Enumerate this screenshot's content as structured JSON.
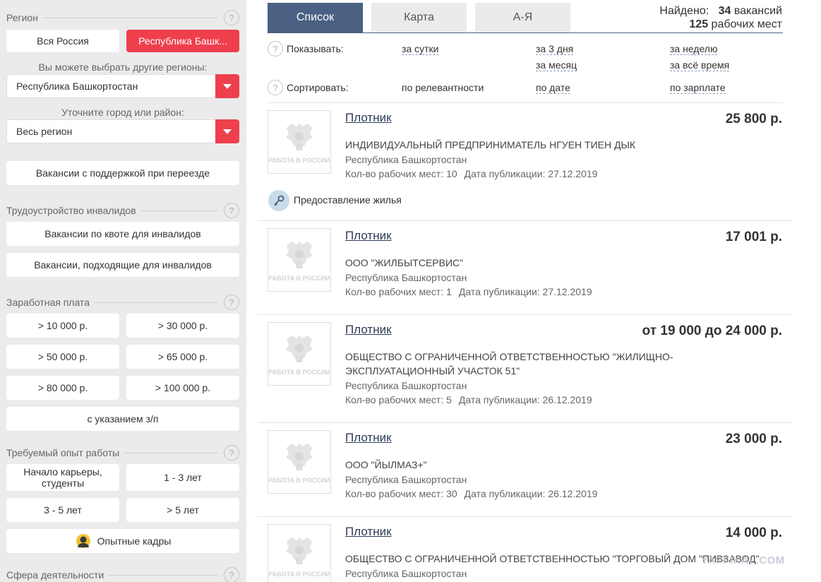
{
  "sidebar": {
    "region": {
      "title": "Регион",
      "help": "?",
      "all_russia": "Вся Россия",
      "selected": "Республика Башк...",
      "choose_hint": "Вы можете выбрать другие регионы:",
      "region_select": "Республика Башкортостан",
      "city_hint": "Уточните город или район:",
      "city_select": "Весь регион"
    },
    "relocation_button": "Вакансии с поддержкой при переезде",
    "disabled": {
      "title": "Трудоустройство инвалидов",
      "help": "?",
      "quota": "Вакансии по квоте для инвалидов",
      "suitable": "Вакансии, подходящие для инвалидов"
    },
    "salary": {
      "title": "Заработная плата",
      "help": "?",
      "options": [
        "> 10 000 р.",
        "> 30 000 р.",
        "> 50 000 р.",
        "> 65 000 р.",
        "> 80 000 р.",
        "> 100 000 р."
      ],
      "with_salary": "с указанием з/п"
    },
    "experience": {
      "title": "Требуемый опыт работы",
      "help": "?",
      "options": [
        "Начало карьеры, студенты",
        "1 - 3 лет",
        "3 - 5 лет",
        "> 5 лет"
      ],
      "experienced": "Опытные кадры"
    },
    "sphere": {
      "title": "Сфера деятельности",
      "help": "?"
    }
  },
  "tabs": [
    "Список",
    "Карта",
    "А-Я"
  ],
  "found": {
    "label": "Найдено:",
    "vacancies_count": "34",
    "vacancies_word": "вакансий",
    "places_count": "125",
    "places_word": "рабочих мест"
  },
  "filters": {
    "show_label": "Показывать:",
    "show_options": [
      "за сутки",
      "за 3 дня",
      "за неделю",
      "за месяц",
      "за всё время"
    ],
    "sort_label": "Сортировать:",
    "sort_options": [
      "по релевантности",
      "по дате",
      "по зарплате"
    ],
    "help": "?"
  },
  "logo_text": "РАБОТА В РОССИИ",
  "housing": "Предоставление жилья",
  "jobs": [
    {
      "title": "Плотник",
      "salary": "25 800 р.",
      "company": "ИНДИВИДУАЛЬНЫЙ ПРЕДПРИНИМАТЕЛЬ НГУЕН ТИЕН ДЫК",
      "region": "Республика Башкортостан",
      "places": "Кол-во рабочих мест: 10",
      "date": "Дата публикации: 27.12.2019"
    },
    {
      "title": "Плотник",
      "salary": "17 001 р.",
      "company": "ООО \"ЖИЛБЫТСЕРВИС\"",
      "region": "Республика Башкортостан",
      "places": "Кол-во рабочих мест: 1",
      "date": "Дата публикации: 27.12.2019"
    },
    {
      "title": "Плотник",
      "salary": "от 19 000 до 24 000 р.",
      "company": "ОБЩЕСТВО С ОГРАНИЧЕННОЙ ОТВЕТСТВЕННОСТЬЮ \"ЖИЛИЩНО-ЭКСПЛУАТАЦИОННЫЙ УЧАСТОК 51\"",
      "region": "Республика Башкортостан",
      "places": "Кол-во рабочих мест: 5",
      "date": "Дата публикации: 26.12.2019"
    },
    {
      "title": "Плотник",
      "salary": "23 000 р.",
      "company": "ООО \"ЙЫЛМАЗ+\"",
      "region": "Республика Башкортостан",
      "places": "Кол-во рабочих мест: 30",
      "date": "Дата публикации: 26.12.2019"
    },
    {
      "title": "Плотник",
      "salary": "14 000 р.",
      "company": "ОБЩЕСТВО С ОГРАНИЧЕННОЙ ОТВЕТСТВЕННОСТЬЮ \"ТОРГОВЫЙ ДОМ \"ПИВЗАВОД\"",
      "region": "Республика Башкортостан"
    }
  ],
  "watermark": "YAPFIKAL.COM",
  "colors": {
    "accent_red": "#ef3f4d",
    "tab_active": "#4a6183",
    "sidebar_bg": "#ebebeb"
  }
}
